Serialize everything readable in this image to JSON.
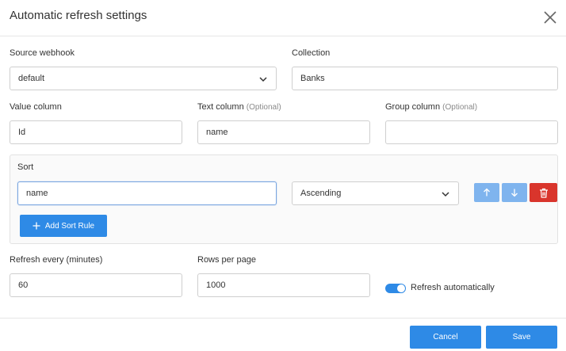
{
  "dialog": {
    "title": "Automatic refresh settings",
    "close_icon": "close-icon"
  },
  "source_webhook": {
    "label": "Source webhook",
    "value": "default",
    "icon": "chevron-down-icon"
  },
  "collection": {
    "label": "Collection",
    "value": "Banks"
  },
  "value_column": {
    "label": "Value column",
    "value": "Id"
  },
  "text_column": {
    "label": "Text column",
    "optional": "(Optional)",
    "value": "name"
  },
  "group_column": {
    "label": "Group column",
    "optional": "(Optional)",
    "value": ""
  },
  "sort": {
    "label": "Sort",
    "rule": {
      "field": "name",
      "direction": "Ascending",
      "move_up_icon": "arrow-up-icon",
      "move_down_icon": "arrow-down-icon",
      "delete_icon": "trash-icon"
    },
    "add_rule_label": "Add Sort Rule",
    "add_icon": "plus-icon"
  },
  "refresh_every": {
    "label": "Refresh every (minutes)",
    "value": "60"
  },
  "rows_per_page": {
    "label": "Rows per page",
    "value": "1000"
  },
  "refresh_automatically": {
    "label": "Refresh automatically",
    "enabled": true
  },
  "footer": {
    "cancel_label": "Cancel",
    "save_label": "Save"
  },
  "colors": {
    "primary": "#2e8ae6",
    "primary_light": "#7fb4ee",
    "danger": "#d9352c"
  }
}
